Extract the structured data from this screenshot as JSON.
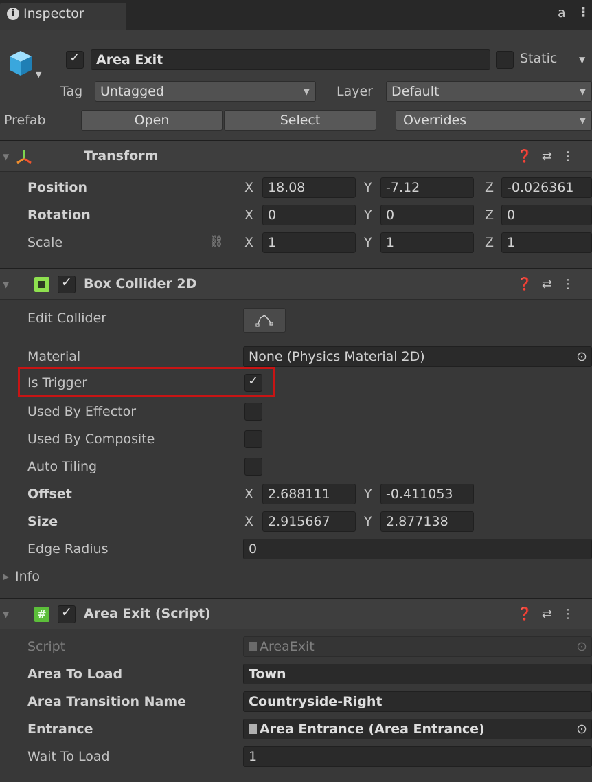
{
  "tab": {
    "label": "Inspector",
    "lock_icon": "lock-icon",
    "menu_icon": "kebab-icon"
  },
  "object": {
    "name": "Area Exit",
    "active": true,
    "static_label": "Static",
    "static": false,
    "tag_label": "Tag",
    "tag_value": "Untagged",
    "layer_label": "Layer",
    "layer_value": "Default"
  },
  "prefab": {
    "label": "Prefab",
    "open": "Open",
    "select": "Select",
    "overrides": "Overrides"
  },
  "transform": {
    "title": "Transform",
    "position_label": "Position",
    "rotation_label": "Rotation",
    "scale_label": "Scale",
    "position": {
      "x": "18.08",
      "y": "-7.12",
      "z": "-0.026361"
    },
    "rotation": {
      "x": "0",
      "y": "0",
      "z": "0"
    },
    "scale": {
      "x": "1",
      "y": "1",
      "z": "1"
    },
    "axes": {
      "x": "X",
      "y": "Y",
      "z": "Z"
    }
  },
  "box_collider": {
    "title": "Box Collider 2D",
    "enabled": true,
    "edit_collider_label": "Edit Collider",
    "material_label": "Material",
    "material_value": "None (Physics Material 2D)",
    "is_trigger_label": "Is Trigger",
    "is_trigger": true,
    "used_by_effector_label": "Used By Effector",
    "used_by_composite_label": "Used By Composite",
    "auto_tiling_label": "Auto Tiling",
    "offset_label": "Offset",
    "offset": {
      "x": "2.688111",
      "y": "-0.411053"
    },
    "size_label": "Size",
    "size": {
      "x": "2.915667",
      "y": "2.877138"
    },
    "edge_radius_label": "Edge Radius",
    "edge_radius": "0",
    "info_label": "Info",
    "highlight_color": "#c81414"
  },
  "area_exit_script": {
    "title": "Area Exit (Script)",
    "enabled": true,
    "script_label": "Script",
    "script_value": "AreaExit",
    "area_to_load_label": "Area To Load",
    "area_to_load": "Town",
    "area_transition_name_label": "Area Transition Name",
    "area_transition_name": "Countryside-Right",
    "entrance_label": "Entrance",
    "entrance_value": "Area Entrance (Area Entrance)",
    "wait_to_load_label": "Wait To Load",
    "wait_to_load": "1"
  }
}
